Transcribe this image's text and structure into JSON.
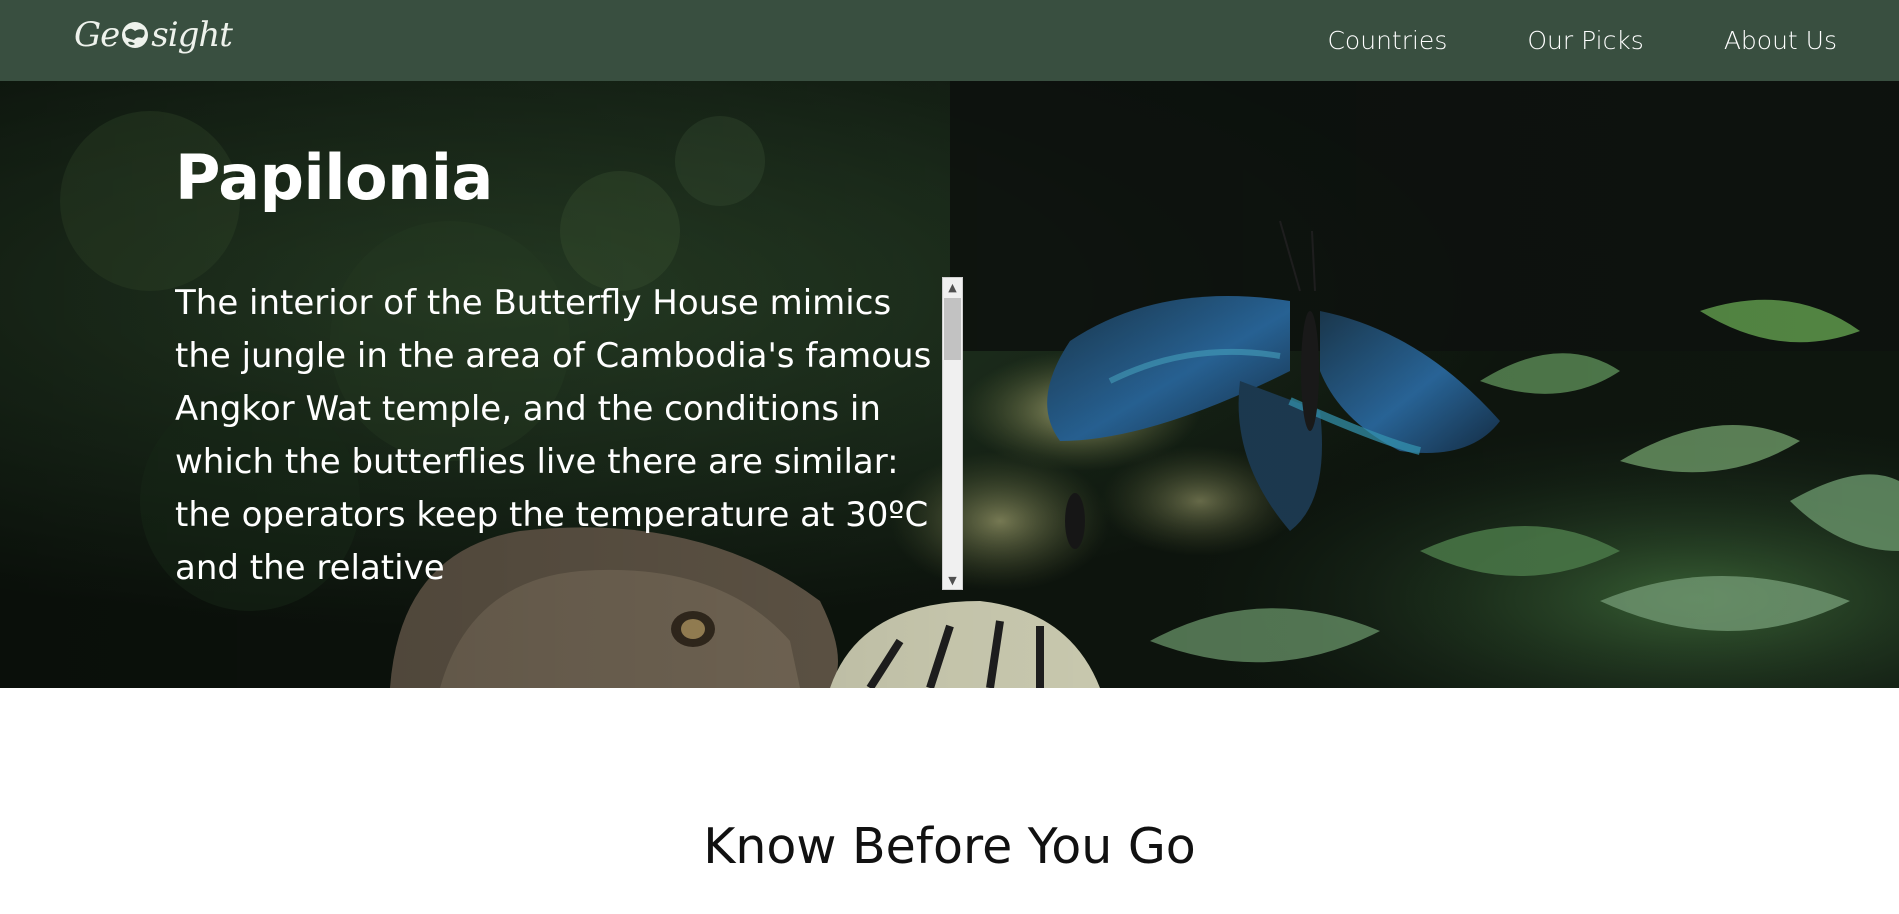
{
  "header": {
    "logo_text": "Geosight",
    "logo_prefix": "Ge",
    "logo_suffix": "sight",
    "background_color": "#394f40",
    "nav": [
      {
        "label": "Countries"
      },
      {
        "label": "Our Picks"
      },
      {
        "label": "About Us"
      }
    ]
  },
  "hero": {
    "title": "Papilonia",
    "description": "The interior of the Butterfly House mimics the jungle in the area of Cambodia's famous Angkor Wat temple, and the conditions in which the butterflies live there are similar: the operators keep the temperature at 30ºC and the relative",
    "background_image": "butterflies-on-flowers-photo",
    "scroll_up_icon": "chevron-up-icon",
    "scroll_down_icon": "chevron-down-icon"
  },
  "section": {
    "heading": "Know Before You Go"
  }
}
